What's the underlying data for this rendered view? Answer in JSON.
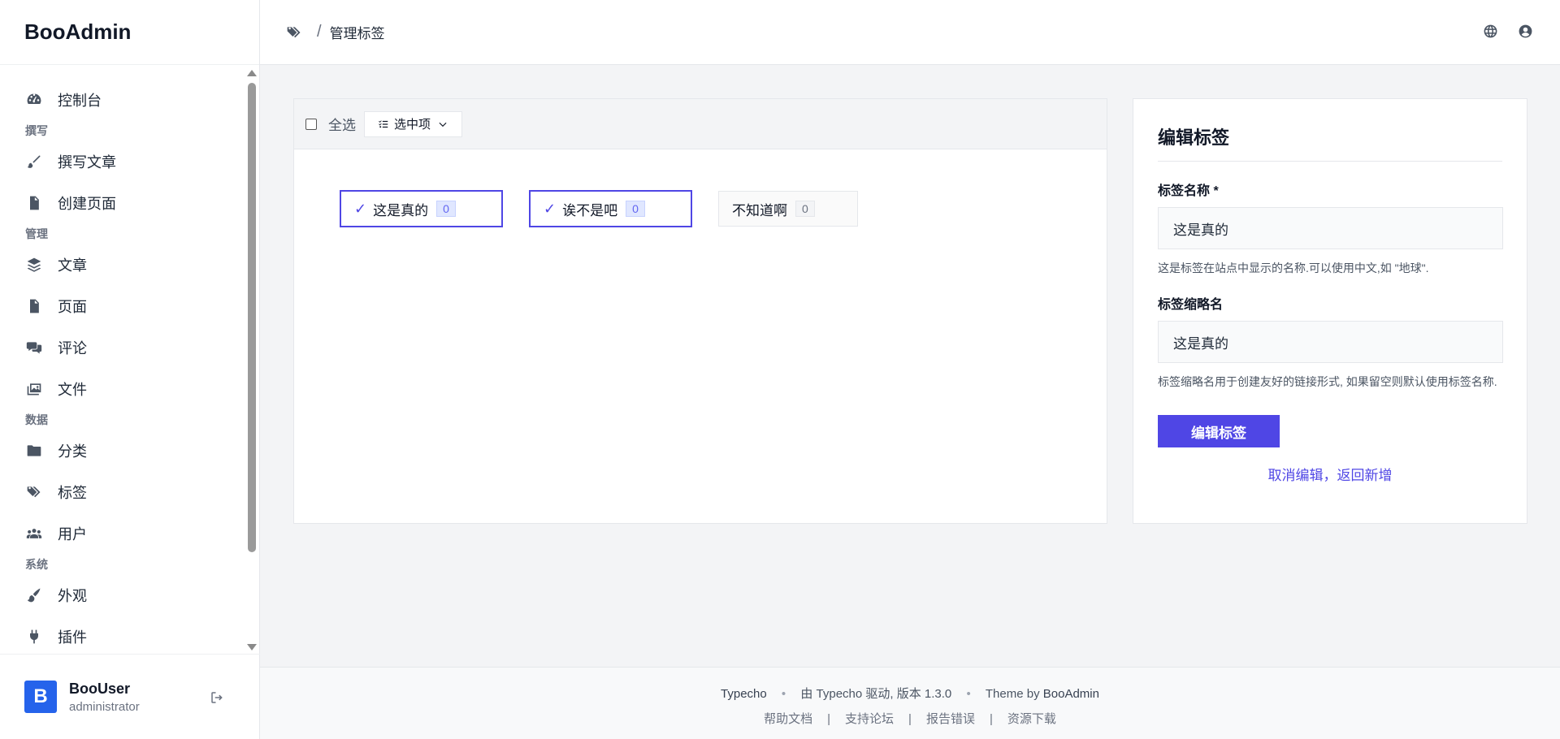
{
  "brand": "BooAdmin",
  "sidebar": {
    "items": [
      {
        "type": "item",
        "label": "控制台",
        "icon": "dashboard-icon"
      },
      {
        "type": "section",
        "label": "撰写"
      },
      {
        "type": "item",
        "label": "撰写文章",
        "icon": "brush-icon"
      },
      {
        "type": "item",
        "label": "创建页面",
        "icon": "document-icon"
      },
      {
        "type": "section",
        "label": "管理"
      },
      {
        "type": "item",
        "label": "文章",
        "icon": "layers-icon"
      },
      {
        "type": "item",
        "label": "页面",
        "icon": "file-icon"
      },
      {
        "type": "item",
        "label": "评论",
        "icon": "comments-icon"
      },
      {
        "type": "item",
        "label": "文件",
        "icon": "images-icon"
      },
      {
        "type": "section",
        "label": "数据"
      },
      {
        "type": "item",
        "label": "分类",
        "icon": "folder-icon"
      },
      {
        "type": "item",
        "label": "标签",
        "icon": "tags-icon"
      },
      {
        "type": "item",
        "label": "用户",
        "icon": "users-icon"
      },
      {
        "type": "section",
        "label": "系统"
      },
      {
        "type": "item",
        "label": "外观",
        "icon": "paint-brush-icon"
      },
      {
        "type": "item",
        "label": "插件",
        "icon": "plug-icon"
      }
    ]
  },
  "user": {
    "initial": "B",
    "name": "BooUser",
    "role": "administrator"
  },
  "header": {
    "breadcrumb_sep": "/",
    "title": "管理标签"
  },
  "toolbar": {
    "select_all": "全选",
    "bulk_label": "选中项"
  },
  "tags": [
    {
      "name": "这是真的",
      "count": "0",
      "selected": true
    },
    {
      "name": "诶不是吧",
      "count": "0",
      "selected": true
    },
    {
      "name": "不知道啊",
      "count": "0",
      "selected": false
    }
  ],
  "form": {
    "title": "编辑标签",
    "name_label": "标签名称 *",
    "name_value": "这是真的",
    "name_help": "这是标签在站点中显示的名称.可以使用中文,如 \"地球\".",
    "slug_label": "标签缩略名",
    "slug_value": "这是真的",
    "slug_help": "标签缩略名用于创建友好的链接形式, 如果留空则默认使用标签名称.",
    "submit": "编辑标签",
    "cancel": "取消编辑，返回新增"
  },
  "footer": {
    "app": "Typecho",
    "powered": "由 Typecho 驱动, 版本 1.3.0",
    "theme_prefix": "Theme by ",
    "theme_name": "BooAdmin",
    "sep": "|",
    "links": [
      "帮助文档",
      "支持论坛",
      "报告错误",
      "资源下载"
    ]
  },
  "colors": {
    "accent": "#4f46e5",
    "avatar": "#2563eb"
  }
}
